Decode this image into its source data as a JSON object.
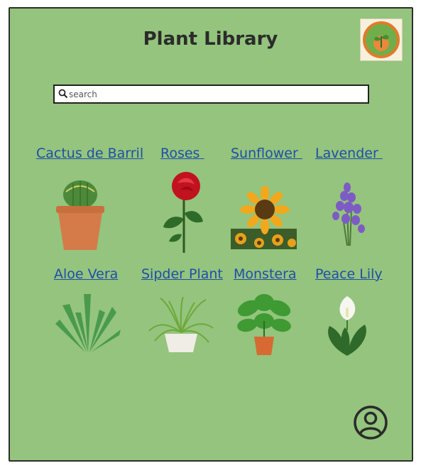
{
  "header": {
    "title": "Plant Library"
  },
  "search": {
    "placeholder": "search"
  },
  "plants": [
    {
      "label": "Cactus de Barril",
      "icon": "cactus-image"
    },
    {
      "label": "Roses ",
      "icon": "rose-image"
    },
    {
      "label": "Sunflower ",
      "icon": "sunflower-image"
    },
    {
      "label": "Lavender ",
      "icon": "lavender-image"
    },
    {
      "label": "Aloe Vera",
      "icon": "aloe-vera-image"
    },
    {
      "label": "Sipder Plant",
      "icon": "spider-plant-image"
    },
    {
      "label": "Monstera",
      "icon": "monstera-image"
    },
    {
      "label": "Peace Lily",
      "icon": "peace-lily-image"
    }
  ],
  "colors": {
    "background": "#94c47d",
    "link": "#1f4ea8",
    "border": "#2e2e2e"
  },
  "icons": {
    "logo": "sproutsmart-logo",
    "search": "search-icon",
    "profile": "profile-icon"
  }
}
